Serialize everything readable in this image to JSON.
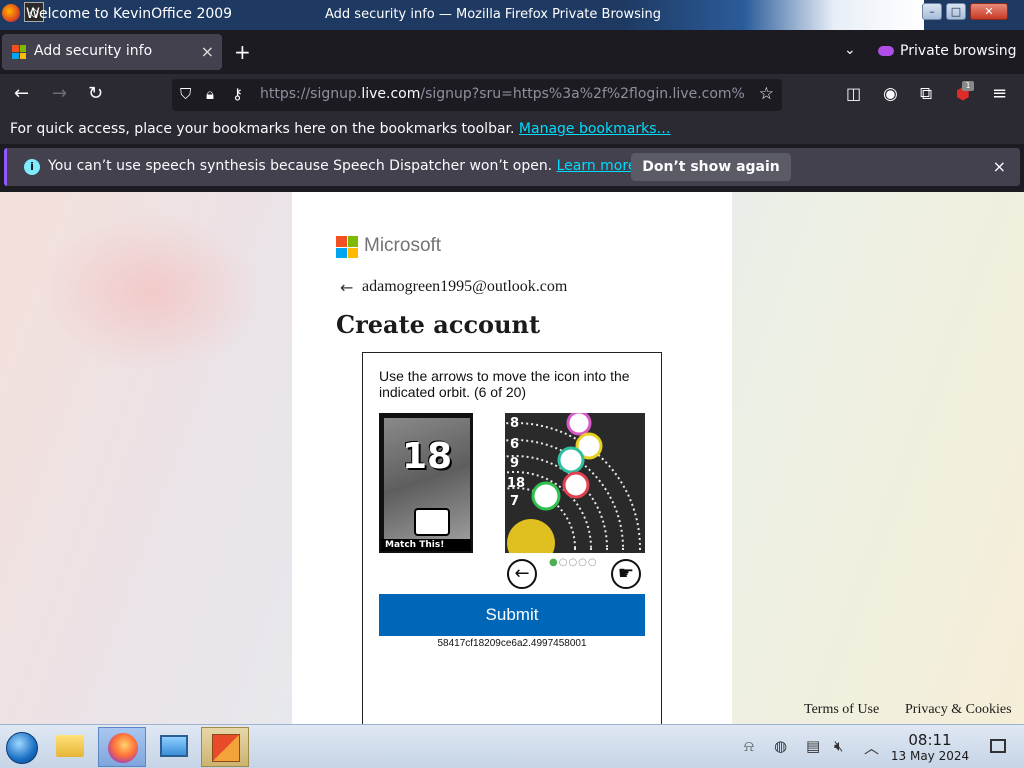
{
  "titlebar": {
    "left_title": "Welcome to KevinOffice 2009",
    "window_title": "Add security info — Mozilla Firefox Private Browsing",
    "minimize": "–",
    "maximize": "□",
    "close": "✕"
  },
  "tabs": {
    "active_title": "Add security info",
    "close": "×",
    "new_tab": "+",
    "list_all": "⌄",
    "private_label": "Private browsing"
  },
  "nav": {
    "url_prefix": "https://signup.",
    "url_domain": "live.com",
    "url_rest": "/signup?sru=https%3a%2f%2flogin.live.com%",
    "extension_badge": "1"
  },
  "bookmarks": {
    "text": "For quick access, place your bookmarks here on the bookmarks toolbar. ",
    "link": "Manage bookmarks…"
  },
  "notification": {
    "message": "You can’t use speech synthesis because Speech Dispatcher won’t open. ",
    "learn_more": "Learn more",
    "dont_show": "Don’t show again",
    "close": "×"
  },
  "page": {
    "brand": "Microsoft",
    "email": "adamogreen1995@outlook.com",
    "heading": "Create account",
    "captcha": {
      "instruction": "Use the arrows to move the icon into the indicated orbit. (6 of 20)",
      "target_number": "18",
      "match_label": "Match This!",
      "orbit_numbers": [
        "8",
        "6",
        "9",
        "18",
        "7"
      ],
      "progress_current": 1,
      "progress_total": 5,
      "submit": "Submit",
      "token": "58417cf18209ce6a2.4997458001"
    },
    "footer": {
      "terms": "Terms of Use",
      "privacy": "Privacy & Cookies"
    }
  },
  "taskbar": {
    "time": "08:11",
    "date": "13 May 2024"
  },
  "colors": {
    "ms_red": "#f25022",
    "ms_green": "#7fba00",
    "ms_blue": "#00a4ef",
    "ms_yellow": "#ffb900",
    "submit_blue": "#0067b8",
    "link_cyan": "#00ddff"
  }
}
